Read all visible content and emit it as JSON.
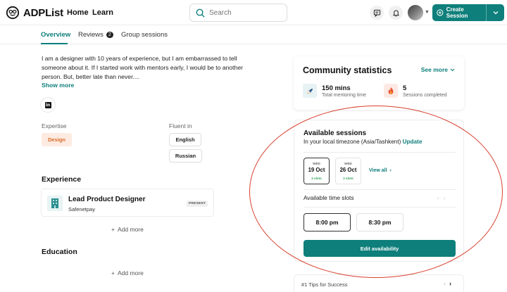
{
  "header": {
    "logo_text": "ADPList",
    "nav": [
      "Home",
      "Learn"
    ],
    "search_placeholder": "Search",
    "create_label": "Create Session"
  },
  "tabs": [
    {
      "label": "Overview",
      "active": true
    },
    {
      "label": "Reviews",
      "badge": "2"
    },
    {
      "label": "Group sessions"
    }
  ],
  "bio": {
    "text": "I am a designer with 10 years of experience, but I am embarrassed to tell someone about it. If I started work with mentors early, I would be to another person. But, better late than never....",
    "show_more": "Show more"
  },
  "expertise": {
    "label": "Expertise",
    "items": [
      "Design"
    ]
  },
  "languages": {
    "label": "Fluent in",
    "items": [
      "English",
      "Russian"
    ]
  },
  "experience": {
    "title": "Experience",
    "role": "Lead Product Designer",
    "company": "Safenetpay",
    "status": "PRESENT",
    "add_more": "Add more"
  },
  "education": {
    "title": "Education",
    "add_more": "Add more"
  },
  "community": {
    "title": "Community statistics",
    "see_more": "See more",
    "stats": [
      {
        "value": "150 mins",
        "label": "Total mentoring time"
      },
      {
        "value": "5",
        "label": "Sessions completed"
      }
    ]
  },
  "sessions": {
    "title": "Available sessions",
    "timezone_prefix": "In your local timezone (Asia/Tashkent)",
    "update": "Update",
    "dates": [
      {
        "dow": "WED",
        "date": "19 Oct",
        "slots": "2 slots",
        "selected": true
      },
      {
        "dow": "WED",
        "date": "26 Oct",
        "slots": "2 slots",
        "selected": false
      }
    ],
    "view_all": "View all",
    "time_label": "Available time slots",
    "times": [
      {
        "label": "8:00 pm",
        "selected": true
      },
      {
        "label": "8:30 pm",
        "selected": false
      }
    ],
    "edit_label": "Edit availability"
  },
  "tips": {
    "text": "#1 Tips for Success"
  },
  "colors": {
    "accent": "#0e7f7b",
    "expertise_bg": "#fdebe1",
    "expertise_text": "#d96a2b",
    "annotation": "#d9402f"
  }
}
